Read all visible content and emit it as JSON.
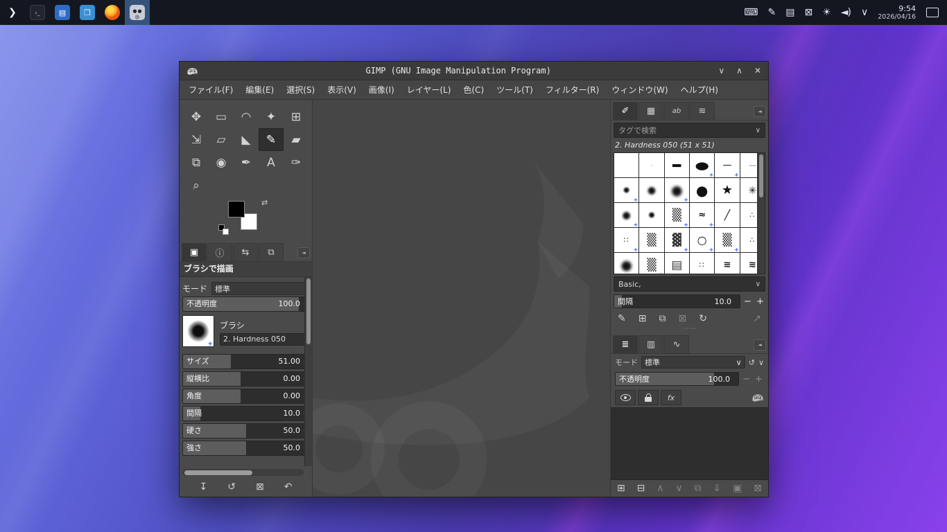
{
  "glyphs": {
    "chevron_down": "∨",
    "minus": "−",
    "plus": "+",
    "spin": "‒",
    "grip_dots": "⋯⋯",
    "corner_menu": "◄",
    "terminal": "›_"
  },
  "taskbar": {
    "launchers": [
      {
        "name": "launcher-app-menu",
        "g": "❯",
        "cls": "lch-logo"
      },
      {
        "name": "launcher-terminal",
        "g": "›_",
        "cls": "lch-term"
      },
      {
        "name": "launcher-editor",
        "g": "▤",
        "cls": "lch-blue"
      },
      {
        "name": "launcher-file-manager",
        "g": "❐",
        "cls": "lch-blue2"
      },
      {
        "name": "launcher-firefox",
        "g": "",
        "cls": "lch-ff"
      },
      {
        "name": "launcher-gimp",
        "g": "",
        "cls": "lch-gimp",
        "cell_cls": "active-launcher"
      }
    ],
    "tray": [
      {
        "name": "keyboard-layout-icon",
        "g": "⌨"
      },
      {
        "name": "tablet-settings-icon",
        "g": "✎"
      },
      {
        "name": "clipboard-icon",
        "g": "▤"
      },
      {
        "name": "display-off-icon",
        "g": "⊠"
      },
      {
        "name": "brightness-icon",
        "g": "☀"
      },
      {
        "name": "volume-icon",
        "g": "◄)"
      },
      {
        "name": "tray-expander-icon",
        "g": "∨"
      }
    ],
    "clock_time": "9:54",
    "clock_date": "2026/04/16"
  },
  "window": {
    "title": "GIMP (GNU Image Manipulation Program)",
    "controls": [
      {
        "name": "minimize-button",
        "g": "∨"
      },
      {
        "name": "maximize-button",
        "g": "∧"
      },
      {
        "name": "close-button",
        "g": "✕"
      }
    ],
    "menus": [
      "ファイル(F)",
      "編集(E)",
      "選択(S)",
      "表示(V)",
      "画像(I)",
      "レイヤー(L)",
      "色(C)",
      "ツール(T)",
      "フィルター(R)",
      "ウィンドウ(W)",
      "ヘルプ(H)"
    ]
  },
  "toolbox": {
    "tools": [
      {
        "name": "move-tool",
        "g": "✥"
      },
      {
        "name": "rectangle-select-tool",
        "g": "▭"
      },
      {
        "name": "free-select-tool",
        "g": "◠"
      },
      {
        "name": "fuzzy-select-tool",
        "g": "✦"
      },
      {
        "name": "crop-tool",
        "g": "⊞"
      },
      {
        "name": "transform-tool",
        "g": "⇲"
      },
      {
        "name": "handle-transform-tool",
        "g": "▱"
      },
      {
        "name": "bucket-fill-tool",
        "g": "◣"
      },
      {
        "name": "paintbrush-tool",
        "g": "✎",
        "cls": "active"
      },
      {
        "name": "eraser-tool",
        "g": "▰"
      },
      {
        "name": "clone-tool",
        "g": "⧉"
      },
      {
        "name": "smudge-tool",
        "g": "◉"
      },
      {
        "name": "ink-tool",
        "g": "✒"
      },
      {
        "name": "text-tool",
        "g": "A"
      },
      {
        "name": "color-picker-tool",
        "g": "✑"
      },
      {
        "name": "zoom-tool",
        "g": "⌕"
      }
    ]
  },
  "tool_options": {
    "tabs": [
      {
        "name": "tool-options-tab",
        "g": "▣",
        "cls": "active"
      },
      {
        "name": "device-status-tab",
        "g": "ⓘ"
      },
      {
        "name": "undo-history-tab",
        "g": "⇆"
      },
      {
        "name": "images-tab",
        "g": "⧉"
      }
    ],
    "title": "ブラシで描画",
    "mode_label": "モード",
    "mode_value": "標準",
    "opacity_label": "不透明度",
    "opacity_value": "100.0",
    "opacity_fill": "92%",
    "brush_label": "ブラシ",
    "brush_name": "2. Hardness 050",
    "sliders": [
      {
        "name": "size-slider",
        "label": "サイズ",
        "value": "51.00",
        "fill": "38%"
      },
      {
        "name": "aspect-ratio-slider",
        "label": "縦横比",
        "value": "0.00",
        "fill": "46%"
      },
      {
        "name": "angle-slider",
        "label": "角度",
        "value": "0.00",
        "fill": "46%"
      },
      {
        "name": "spacing-slider",
        "label": "間隔",
        "value": "10.0",
        "fill": "14%"
      },
      {
        "name": "hardness-slider",
        "label": "硬さ",
        "value": "50.0",
        "fill": "50%"
      },
      {
        "name": "force-slider",
        "label": "強さ",
        "value": "50.0",
        "fill": "50%"
      }
    ],
    "actions": [
      {
        "name": "save-tool-preset-button",
        "g": "↧"
      },
      {
        "name": "restore-tool-preset-button",
        "g": "↺"
      },
      {
        "name": "delete-tool-preset-button",
        "g": "⊠"
      },
      {
        "name": "reset-tool-options-button",
        "g": "↶"
      }
    ]
  },
  "brushes": {
    "tabs": [
      {
        "name": "brushes-tab",
        "g": "✐",
        "cls": "active"
      },
      {
        "name": "patterns-tab",
        "g": "▦"
      },
      {
        "name": "fonts-tab",
        "g": "ab",
        "cls": "txt"
      },
      {
        "name": "gradients-tab",
        "g": "≋"
      }
    ],
    "search_placeholder": "タグで検索",
    "info": "2. Hardness 050 (51 x 51)",
    "grid": [
      {
        "g": "",
        "cls": "c-blank"
      },
      {
        "g": "·",
        "cls": "c-dot"
      },
      {
        "g": "▬",
        "cls": "c-bar"
      },
      {
        "g": "●",
        "cls": "c-ellipse",
        "plus": "+"
      },
      {
        "g": "—",
        "cls": "c-hline",
        "plus": "+"
      },
      {
        "g": "—",
        "cls": "c-thin"
      },
      {
        "g": "●",
        "cls": "c-soft-s",
        "plus": "+"
      },
      {
        "g": "●",
        "cls": "c-soft-m"
      },
      {
        "g": "●",
        "cls": "c-soft-l",
        "plus": "+"
      },
      {
        "g": "●",
        "cls": "c-solid"
      },
      {
        "g": "★",
        "cls": "c-star"
      },
      {
        "g": "✳",
        "cls": "c-noise",
        "plus": "+"
      },
      {
        "g": "●",
        "cls": "c-soft-m",
        "plus": "+"
      },
      {
        "g": "●",
        "cls": "c-soft-s"
      },
      {
        "g": "▒",
        "cls": "c-grain",
        "plus": "+"
      },
      {
        "g": "≈",
        "cls": "c-scrib",
        "plus": "+"
      },
      {
        "g": "╱",
        "cls": "c-slash"
      },
      {
        "g": "∴",
        "cls": "c-dots",
        "plus": "+"
      },
      {
        "g": "∷",
        "cls": "c-dots",
        "plus": "+"
      },
      {
        "g": "▒",
        "cls": "c-grain"
      },
      {
        "g": "▓",
        "cls": "c-grain",
        "plus": "+"
      },
      {
        "g": "○",
        "cls": "c-ring",
        "plus": "+"
      },
      {
        "g": "▒",
        "cls": "c-grain",
        "plus": "+"
      },
      {
        "g": "∴",
        "cls": "c-dots"
      },
      {
        "g": "●",
        "cls": "c-soft-l"
      },
      {
        "g": "▒",
        "cls": "c-grain",
        "plus": "+"
      },
      {
        "g": "▤",
        "cls": "c-grain"
      },
      {
        "g": "∷",
        "cls": "c-dots"
      },
      {
        "g": "≋",
        "cls": "c-scrib"
      },
      {
        "g": "≋",
        "cls": "c-scrib",
        "plus": "+"
      }
    ],
    "tag_value": "Basic,",
    "spacing_label": "間隔",
    "spacing_value": "10.0",
    "spacing_fill": "6%",
    "actions": [
      {
        "name": "edit-brush-button",
        "g": "✎"
      },
      {
        "name": "new-brush-button",
        "g": "⊞"
      },
      {
        "name": "duplicate-brush-button",
        "g": "⧉"
      },
      {
        "name": "delete-brush-button",
        "g": "⊠",
        "cls": "dim"
      },
      {
        "name": "refresh-brushes-button",
        "g": "↻"
      },
      {
        "name": "open-brush-as-image-button",
        "g": "↗",
        "cls": "dim right-act"
      }
    ]
  },
  "layers": {
    "tabs": [
      {
        "name": "layers-tab",
        "g": "≣",
        "cls": "active"
      },
      {
        "name": "channels-tab",
        "g": "▥"
      },
      {
        "name": "paths-tab",
        "g": "∿"
      }
    ],
    "mode_label": "モード",
    "mode_value": "標準",
    "mode_buttons": [
      {
        "name": "reset-mode-button",
        "g": "↺"
      },
      {
        "name": "mode-options-button",
        "g": "∨"
      }
    ],
    "opacity_label": "不透明度",
    "opacity_value": "100.0",
    "opacity_fill": "80%",
    "fx_label": "fx",
    "actions": [
      {
        "name": "new-layer-button",
        "g": "⊞"
      },
      {
        "name": "new-layer-group-button",
        "g": "⊟"
      },
      {
        "name": "raise-layer-button",
        "g": "∧",
        "cls": "dim"
      },
      {
        "name": "lower-layer-button",
        "g": "∨",
        "cls": "dim"
      },
      {
        "name": "duplicate-layer-button",
        "g": "⧉",
        "cls": "dim"
      },
      {
        "name": "merge-layer-button",
        "g": "⇓",
        "cls": "dim"
      },
      {
        "name": "add-layer-mask-button",
        "g": "▣",
        "cls": "dim"
      },
      {
        "name": "delete-layer-button",
        "g": "⊠",
        "cls": "dim"
      }
    ]
  }
}
